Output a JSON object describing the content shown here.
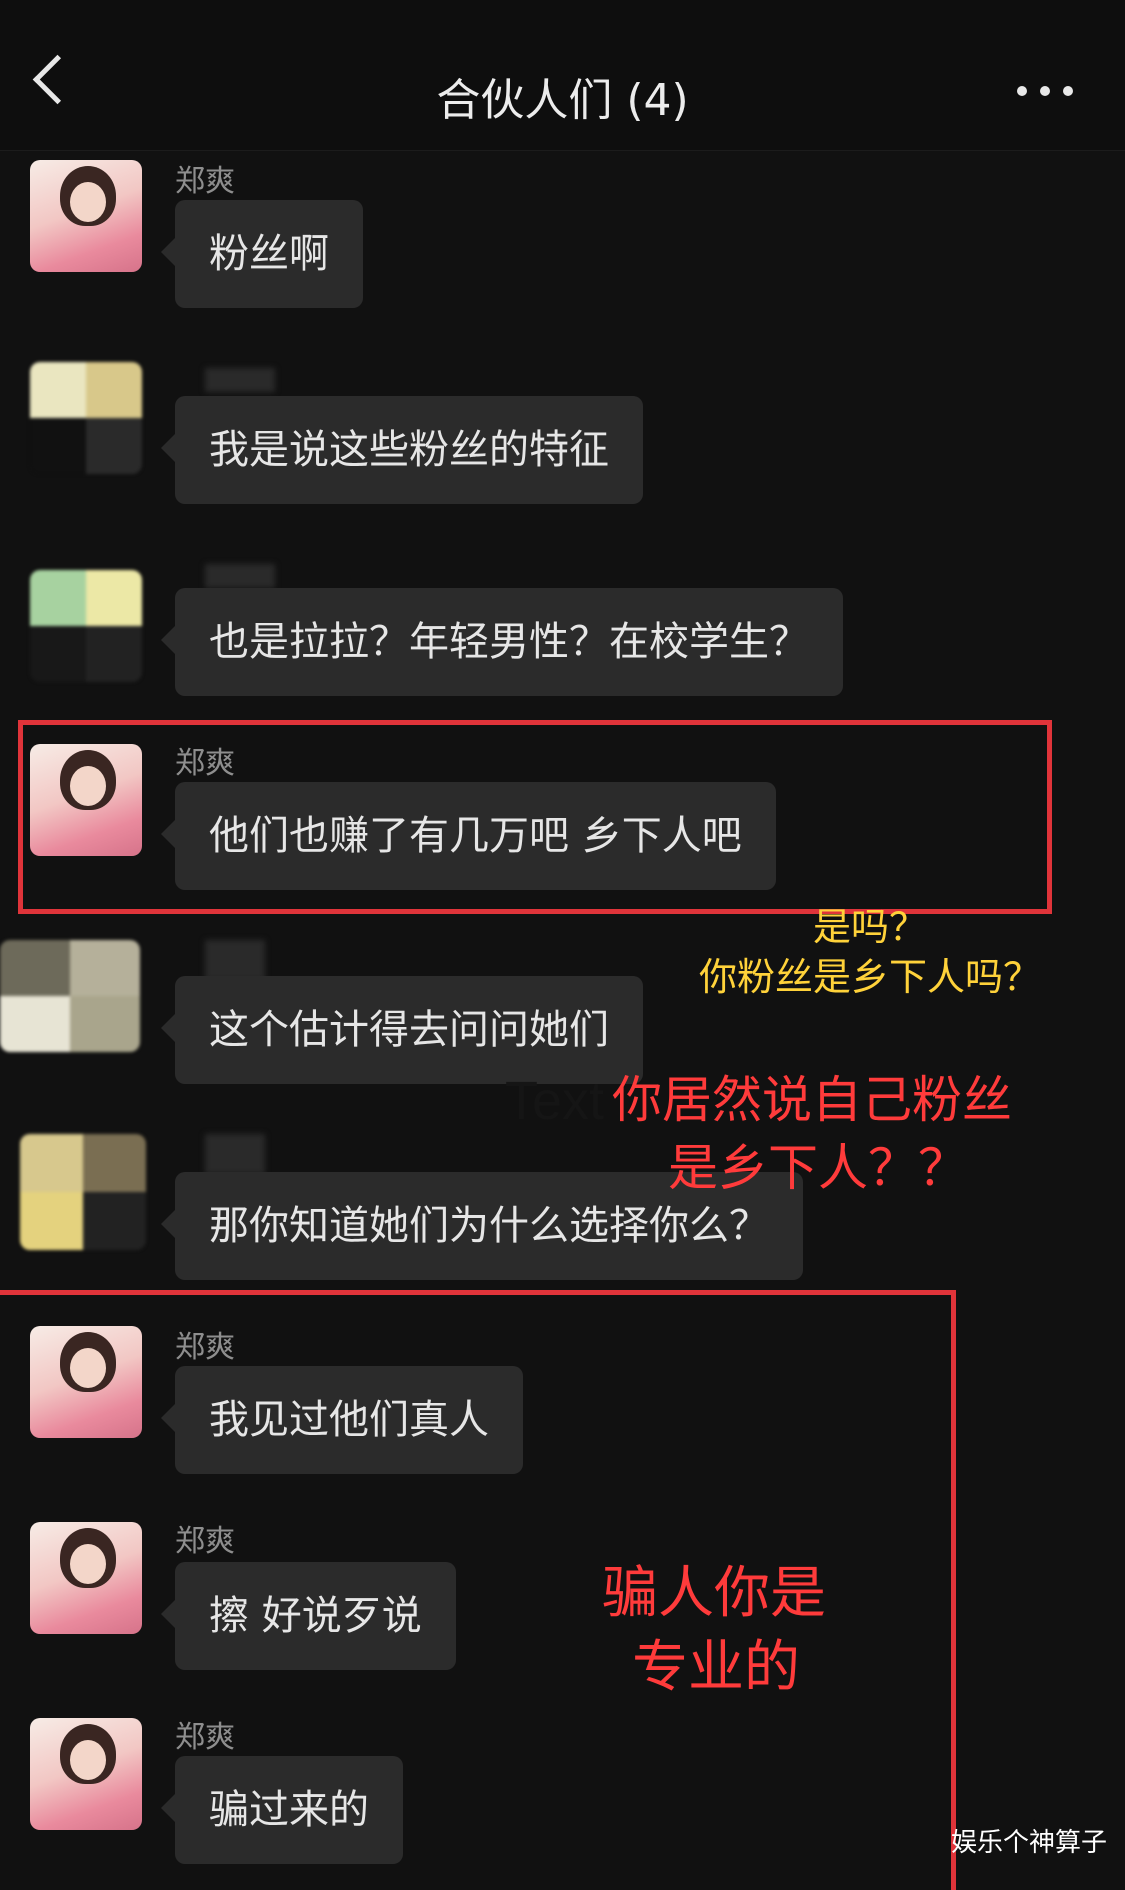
{
  "header": {
    "title": "合伙人们 (4)",
    "back_icon": "chevron-left-icon",
    "more_icon": "more-dots-icon"
  },
  "messages": [
    {
      "sender": "郑爽",
      "text": "粉丝啊"
    },
    {
      "sender": "",
      "text": "我是说这些粉丝的特征"
    },
    {
      "sender": "",
      "text": "也是拉拉？年轻男性？在校学生？"
    },
    {
      "sender": "郑爽",
      "text": "他们也赚了有几万吧 乡下人吧"
    },
    {
      "sender": "",
      "text": "这个估计得去问问她们"
    },
    {
      "sender": "",
      "text": "那你知道她们为什么选择你么？"
    },
    {
      "sender": "郑爽",
      "text": "我见过他们真人"
    },
    {
      "sender": "郑爽",
      "text": "擦 好说歹说"
    },
    {
      "sender": "郑爽",
      "text": "骗过来的"
    }
  ],
  "annotations": {
    "yellow_line1": "是吗？",
    "yellow_line2": "你粉丝是乡下人吗？",
    "red_line1": "你居然说自己粉丝",
    "red_line2": "是乡下人？？",
    "red_bottom_line1": "骗人你是",
    "red_bottom_line2": "专业的",
    "stray_text": "Text"
  },
  "colors": {
    "annotation_red": "#ff3b3b",
    "annotation_yellow": "#ffd23a",
    "frame_red": "#e0343a",
    "bubble": "#2b2b2b"
  },
  "watermark": "娱乐个神算子"
}
